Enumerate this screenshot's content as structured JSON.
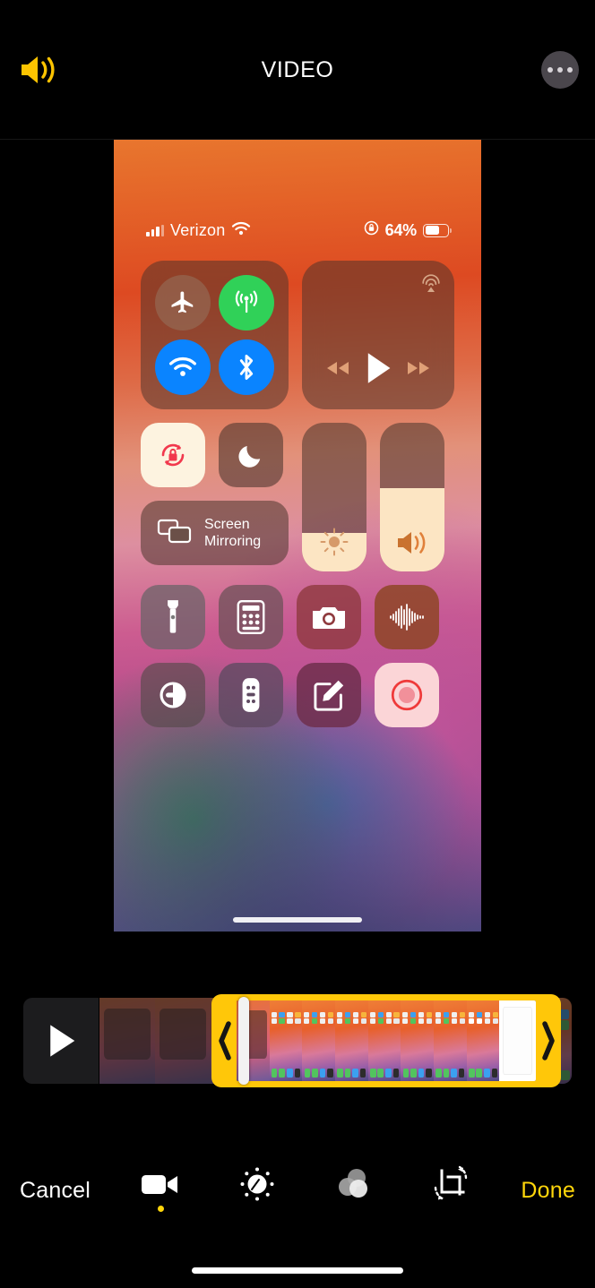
{
  "app": {
    "header": {
      "title": "VIDEO",
      "speaker_icon": "speaker-wave-icon",
      "more_icon": "ellipsis-icon"
    }
  },
  "preview": {
    "description": "iOS Control Center screen recording frame",
    "status_bar": {
      "signal_icon": "cellular-bars-icon",
      "carrier": "Verizon",
      "wifi_icon": "wifi-icon",
      "rotation_lock_icon": "rotation-lock-icon",
      "battery_percent": "64%",
      "battery_icon": "battery-icon",
      "battery_fill": 64
    },
    "control_center": {
      "connectivity": [
        {
          "name": "airplane-mode",
          "icon": "airplane-icon",
          "active": false,
          "color": "#96735f"
        },
        {
          "name": "cellular-data",
          "icon": "cellular-tower-icon",
          "active": true,
          "color": "#30d158"
        },
        {
          "name": "wifi",
          "icon": "wifi-icon",
          "active": true,
          "color": "#0a84ff"
        },
        {
          "name": "bluetooth",
          "icon": "bluetooth-icon",
          "active": true,
          "color": "#0a84ff"
        }
      ],
      "media": {
        "airplay_icon": "airplay-audio-icon",
        "rewind_icon": "rewind-icon",
        "play_icon": "play-icon",
        "forward_icon": "fast-forward-icon"
      },
      "toggles": [
        {
          "name": "rotation-lock",
          "icon": "rotation-lock-icon",
          "active": true
        },
        {
          "name": "do-not-disturb",
          "icon": "moon-icon",
          "active": false
        }
      ],
      "screen_mirroring": {
        "label_line1": "Screen",
        "label_line2": "Mirroring",
        "icon": "screen-mirroring-icon"
      },
      "sliders": [
        {
          "name": "brightness",
          "icon": "brightness-icon",
          "value": 26
        },
        {
          "name": "volume",
          "icon": "volume-icon",
          "value": 56
        }
      ],
      "shortcuts_row1": [
        {
          "name": "flashlight",
          "icon": "flashlight-icon",
          "bg": "#6b6468"
        },
        {
          "name": "calculator",
          "icon": "calculator-icon",
          "bg": "#6d5258"
        },
        {
          "name": "camera",
          "icon": "camera-icon",
          "bg": "#8f3a3e"
        },
        {
          "name": "voice-memos",
          "icon": "waveform-icon",
          "bg": "#8e4526"
        }
      ],
      "shortcuts_row2": [
        {
          "name": "dark-mode",
          "icon": "dark-mode-icon",
          "bg": "#5b5054"
        },
        {
          "name": "apple-tv-remote",
          "icon": "remote-icon",
          "bg": "#5f4a61"
        },
        {
          "name": "notes",
          "icon": "compose-icon",
          "bg": "#6e2f4c"
        },
        {
          "name": "screen-recording",
          "icon": "record-icon",
          "bg": "#fbd5d7",
          "active": true
        }
      ],
      "home_indicator": true
    }
  },
  "timeline": {
    "play_button_icon": "play-icon",
    "left_handle_icon": "chevron-left-icon",
    "right_handle_icon": "chevron-right-icon",
    "playhead": true,
    "trim_color": "#ffc709"
  },
  "toolbar": {
    "cancel_label": "Cancel",
    "done_label": "Done",
    "done_color": "#ffd60a",
    "tools": [
      {
        "name": "trim-tool",
        "icon": "video-camera-icon",
        "active": true
      },
      {
        "name": "adjust-tool",
        "icon": "adjust-dial-icon",
        "active": false
      },
      {
        "name": "filters-tool",
        "icon": "filters-circles-icon",
        "active": false
      },
      {
        "name": "crop-rotate-tool",
        "icon": "crop-rotate-icon",
        "active": false
      }
    ]
  }
}
